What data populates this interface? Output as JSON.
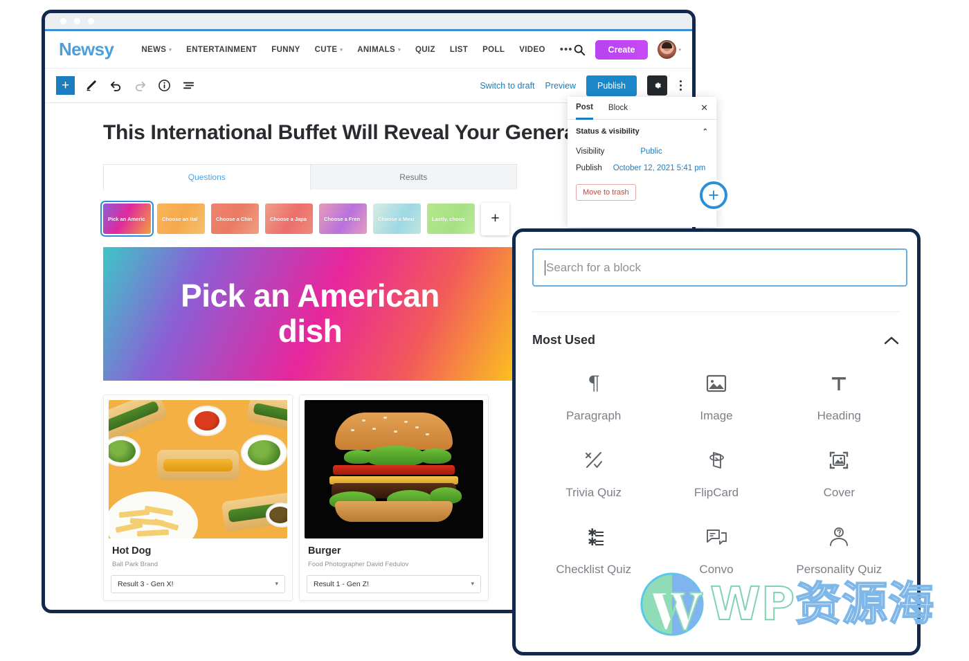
{
  "window": {
    "dots": 3
  },
  "site_nav": {
    "brand": "Newsy",
    "items": [
      {
        "label": "NEWS",
        "caret": true
      },
      {
        "label": "ENTERTAINMENT",
        "caret": false
      },
      {
        "label": "FUNNY",
        "caret": false
      },
      {
        "label": "CUTE",
        "caret": true
      },
      {
        "label": "ANIMALS",
        "caret": true
      },
      {
        "label": "QUIZ",
        "caret": false
      },
      {
        "label": "LIST",
        "caret": false
      },
      {
        "label": "POLL",
        "caret": false
      },
      {
        "label": "VIDEO",
        "caret": false
      }
    ],
    "overflow": "•••",
    "search_icon": "search-icon",
    "create_label": "Create",
    "create_color": "#c14af2",
    "avatar": "user-avatar"
  },
  "editor_toolbar": {
    "inserter_label": "+",
    "inserter_color": "#1b7dc0",
    "icons": [
      "edit-pencil-icon",
      "undo-icon",
      "redo-icon",
      "info-icon",
      "list-view-icon"
    ],
    "switch_to_draft": "Switch to draft",
    "preview": "Preview",
    "publish": "Publish",
    "publish_color": "#1b87c9",
    "settings_icon": "gear-icon",
    "more_icon": "kebab-menu-icon"
  },
  "post": {
    "title": "This International Buffet Will Reveal Your Generation",
    "tabs": [
      {
        "label": "Questions",
        "active": true
      },
      {
        "label": "Results",
        "active": false
      }
    ],
    "question_chips": [
      {
        "label": "Pick an Americ",
        "selected": true,
        "gradient": "linear-gradient(120deg,#8a5fd8 0%,#e0299e 45%,#f4a03c 100%)"
      },
      {
        "label": "Choose an Ital",
        "selected": false,
        "gradient": "linear-gradient(120deg,#f9b657 0%,#f6a94e 50%,#f7c06a 100%)"
      },
      {
        "label": "Choose a Chin",
        "selected": false,
        "gradient": "linear-gradient(120deg,#ef8470 0%,#ea7a63 50%,#f19f84 100%)"
      },
      {
        "label": "Choose a Japa",
        "selected": false,
        "gradient": "linear-gradient(120deg,#ef9f8a 0%,#ec6f6b 55%,#ef8a7c 100%)"
      },
      {
        "label": "Choose a Fren",
        "selected": false,
        "gradient": "linear-gradient(120deg,#e79bb8 0%,#b871dd 55%,#e59cc0 100%)"
      },
      {
        "label": "Choose a Mexi",
        "selected": false,
        "gradient": "linear-gradient(120deg,#d8ece2 0%,#9ed8e4 60%,#bfe6e0 100%)"
      },
      {
        "label": "Lastly, choos",
        "selected": false,
        "gradient": "linear-gradient(120deg,#b7e78c 0%,#a6e085 60%,#bdeb9a 100%)"
      }
    ],
    "add_chip_label": "+",
    "hero_text": "Pick an American dish",
    "answers": [
      {
        "title": "Hot Dog",
        "credit": "Ball Park Brand",
        "result": "Result 3 - Gen X!",
        "image": "hot-dog-photo"
      },
      {
        "title": "Burger",
        "credit": "Food Photographer David Fedulov",
        "result": "Result 1 - Gen Z!",
        "image": "burger-photo"
      }
    ]
  },
  "settings_panel": {
    "tabs": [
      {
        "label": "Post",
        "active": true
      },
      {
        "label": "Block",
        "active": false
      }
    ],
    "close_icon": "close-icon",
    "section_title": "Status & visibility",
    "collapse_icon": "chevron-up-icon",
    "rows": [
      {
        "label": "Visibility",
        "value": "Public"
      },
      {
        "label": "Publish",
        "value": "October 12, 2021 5:41 pm"
      }
    ],
    "trash_label": "Move to trash"
  },
  "float_plus": {
    "label": "+",
    "color": "#2a8fd8"
  },
  "block_inserter": {
    "search_placeholder": "Search for a block",
    "search_value": "",
    "section_title": "Most Used",
    "collapse_icon": "chevron-up-icon",
    "blocks": [
      {
        "label": "Paragraph",
        "icon": "paragraph-icon"
      },
      {
        "label": "Image",
        "icon": "image-icon"
      },
      {
        "label": "Heading",
        "icon": "heading-icon"
      },
      {
        "label": "Trivia Quiz",
        "icon": "trivia-quiz-icon"
      },
      {
        "label": "FlipCard",
        "icon": "flipcard-icon"
      },
      {
        "label": "Cover",
        "icon": "cover-icon"
      },
      {
        "label": "Checklist Quiz",
        "icon": "checklist-quiz-icon"
      },
      {
        "label": "Convo",
        "icon": "convo-icon"
      },
      {
        "label": "Personality Quiz",
        "icon": "personality-quiz-icon"
      }
    ]
  },
  "watermark": {
    "logo": "wordpress-logo",
    "text_latin": "WP",
    "text_cjk": "资源海"
  }
}
